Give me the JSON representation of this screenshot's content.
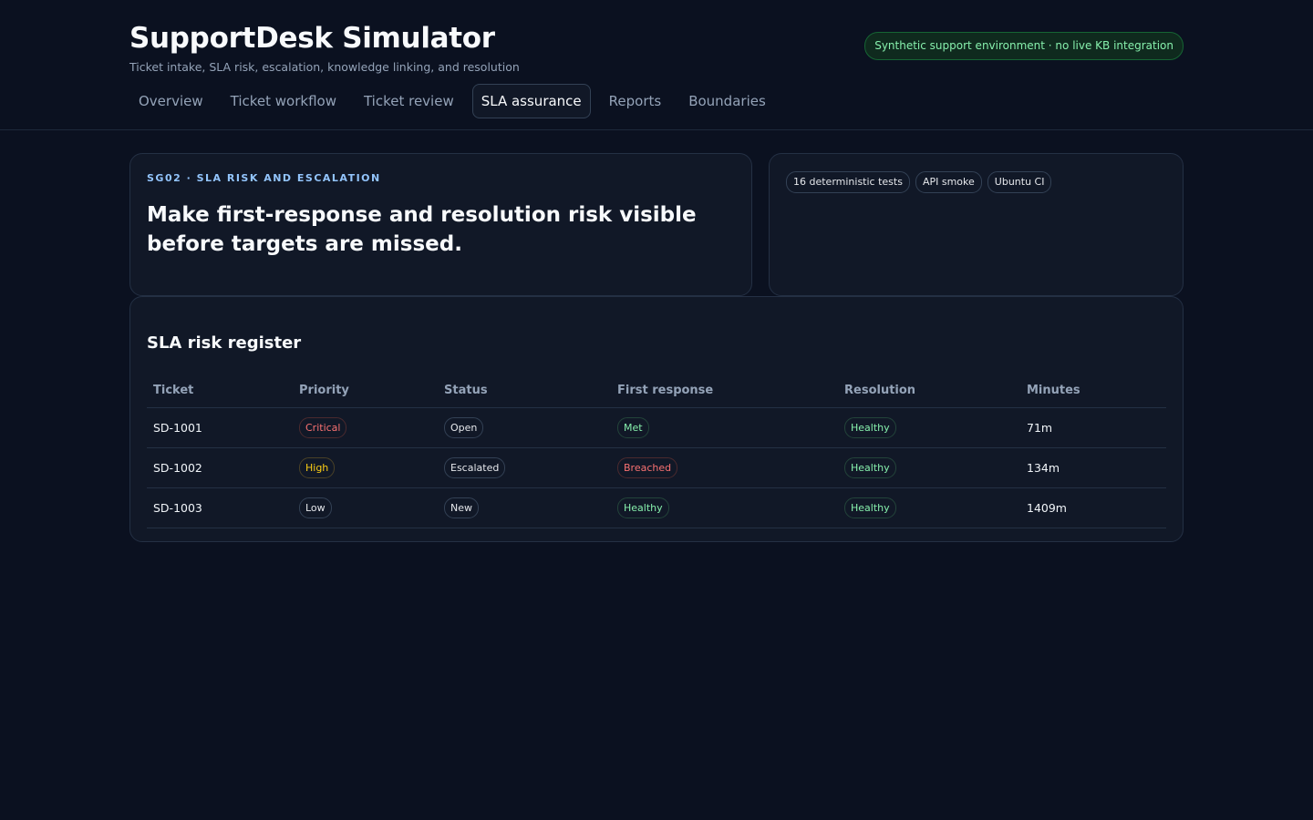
{
  "app": {
    "title": "SupportDesk Simulator",
    "subtitle": "Ticket intake, SLA risk, escalation, knowledge linking, and resolution",
    "environment": "Synthetic support environment · no live KB integration"
  },
  "nav": {
    "items": [
      {
        "label": "Overview"
      },
      {
        "label": "Ticket workflow"
      },
      {
        "label": "Ticket review"
      },
      {
        "label": "SLA assurance",
        "active": true
      },
      {
        "label": "Reports"
      },
      {
        "label": "Boundaries"
      }
    ]
  },
  "intro": {
    "eyebrow": "SG02 · SLA RISK AND ESCALATION",
    "heading": "Make first-response and resolution risk visible before targets are missed."
  },
  "tags": [
    {
      "label": "16 deterministic tests"
    },
    {
      "label": "API smoke"
    },
    {
      "label": "Ubuntu CI"
    }
  ],
  "register": {
    "title": "SLA risk register",
    "columns": [
      "Ticket",
      "Priority",
      "Status",
      "First response",
      "Resolution",
      "Minutes"
    ],
    "rows": [
      {
        "ticket": "SD-1001",
        "priority": "Critical",
        "status": "Open",
        "first_response": "Met",
        "resolution": "Healthy",
        "minutes": "71m"
      },
      {
        "ticket": "SD-1002",
        "priority": "High",
        "status": "Escalated",
        "first_response": "Breached",
        "resolution": "Healthy",
        "minutes": "134m"
      },
      {
        "ticket": "SD-1003",
        "priority": "Low",
        "status": "New",
        "first_response": "Healthy",
        "resolution": "Healthy",
        "minutes": "1409m"
      }
    ]
  },
  "colors": {
    "background": "#0b1120",
    "card": "#111827",
    "accent_green": "#86efac",
    "accent_red": "#f87171",
    "accent_yellow": "#facc15",
    "eyebrow_blue": "#93c5fd"
  }
}
